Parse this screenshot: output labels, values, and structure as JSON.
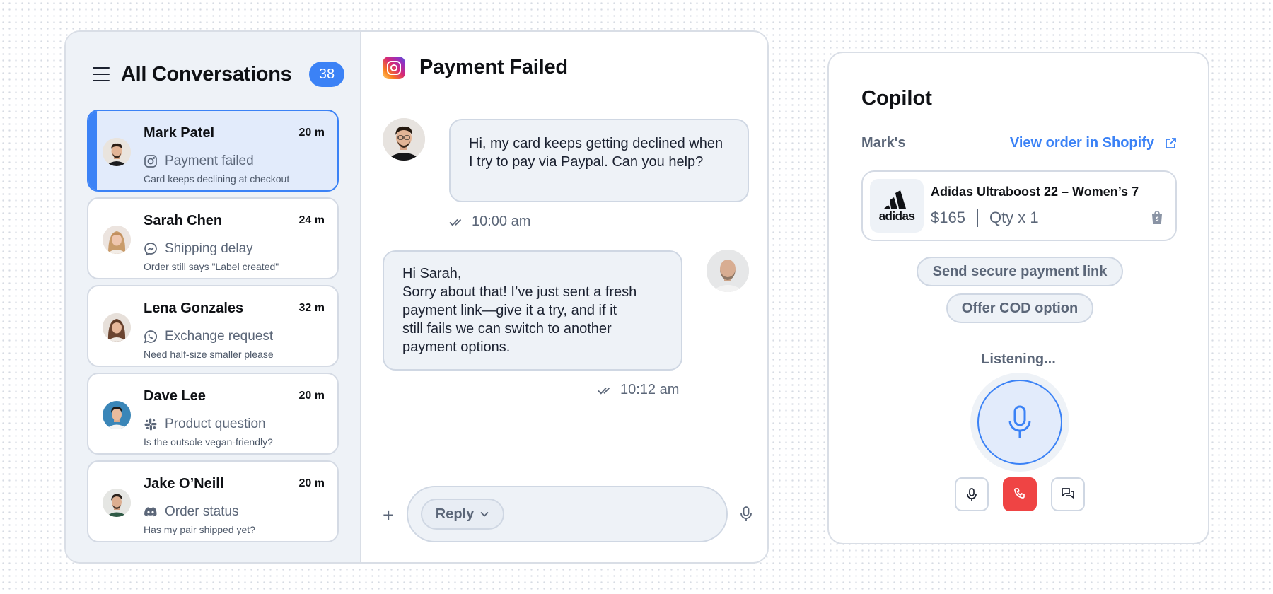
{
  "inbox": {
    "title": "All Conversations",
    "count": "38",
    "conversations": [
      {
        "name": "Mark Patel",
        "time": "20 m",
        "channel_icon": "instagram-icon",
        "subject": "Payment failed",
        "preview": "Card keeps declining at checkout",
        "active": true
      },
      {
        "name": "Sarah Chen",
        "time": "24 m",
        "channel_icon": "messenger-icon",
        "subject": "Shipping delay",
        "preview": "Order still says \"Label created\""
      },
      {
        "name": "Lena Gonzales",
        "time": "32 m",
        "channel_icon": "whatsapp-icon",
        "subject": "Exchange request",
        "preview": "Need half-size smaller please"
      },
      {
        "name": "Dave Lee",
        "time": "20 m",
        "channel_icon": "slack-icon",
        "subject": "Product question",
        "preview": "Is the outsole vegan-friendly?"
      },
      {
        "name": "Jake O’Neill",
        "time": "20 m",
        "channel_icon": "discord-icon",
        "subject": "Order status",
        "preview": "Has my pair shipped yet?"
      }
    ]
  },
  "chat": {
    "channel_icon": "instagram-icon",
    "title": "Payment Failed",
    "messages": [
      {
        "from": "customer",
        "text": "Hi, my card keeps getting declined when I try to pay via Paypal. Can you help?",
        "time": "10:00 am"
      },
      {
        "from": "agent",
        "text_lines": [
          "Hi Sarah,",
          "Sorry about that! I’ve just sent a fresh",
          "payment link—give it a try, and if it",
          "still fails we can switch to another",
          "payment options."
        ],
        "time": "10:12 am"
      }
    ],
    "composer": {
      "reply_label": "Reply"
    }
  },
  "copilot": {
    "title": "Copilot",
    "customer_label": "Mark's",
    "shopify_link": "View order in Shopify",
    "order": {
      "brand": "adidas",
      "product": "Adidas Ultraboost 22 – Women’s 7",
      "price": "$165",
      "qty": "Qty x 1"
    },
    "suggestions": [
      "Send secure payment link",
      "Offer COD option"
    ],
    "status": "Listening...",
    "colors": {
      "accent": "#3b82f6",
      "danger": "#ef4444",
      "muted": "#5b6678"
    }
  }
}
